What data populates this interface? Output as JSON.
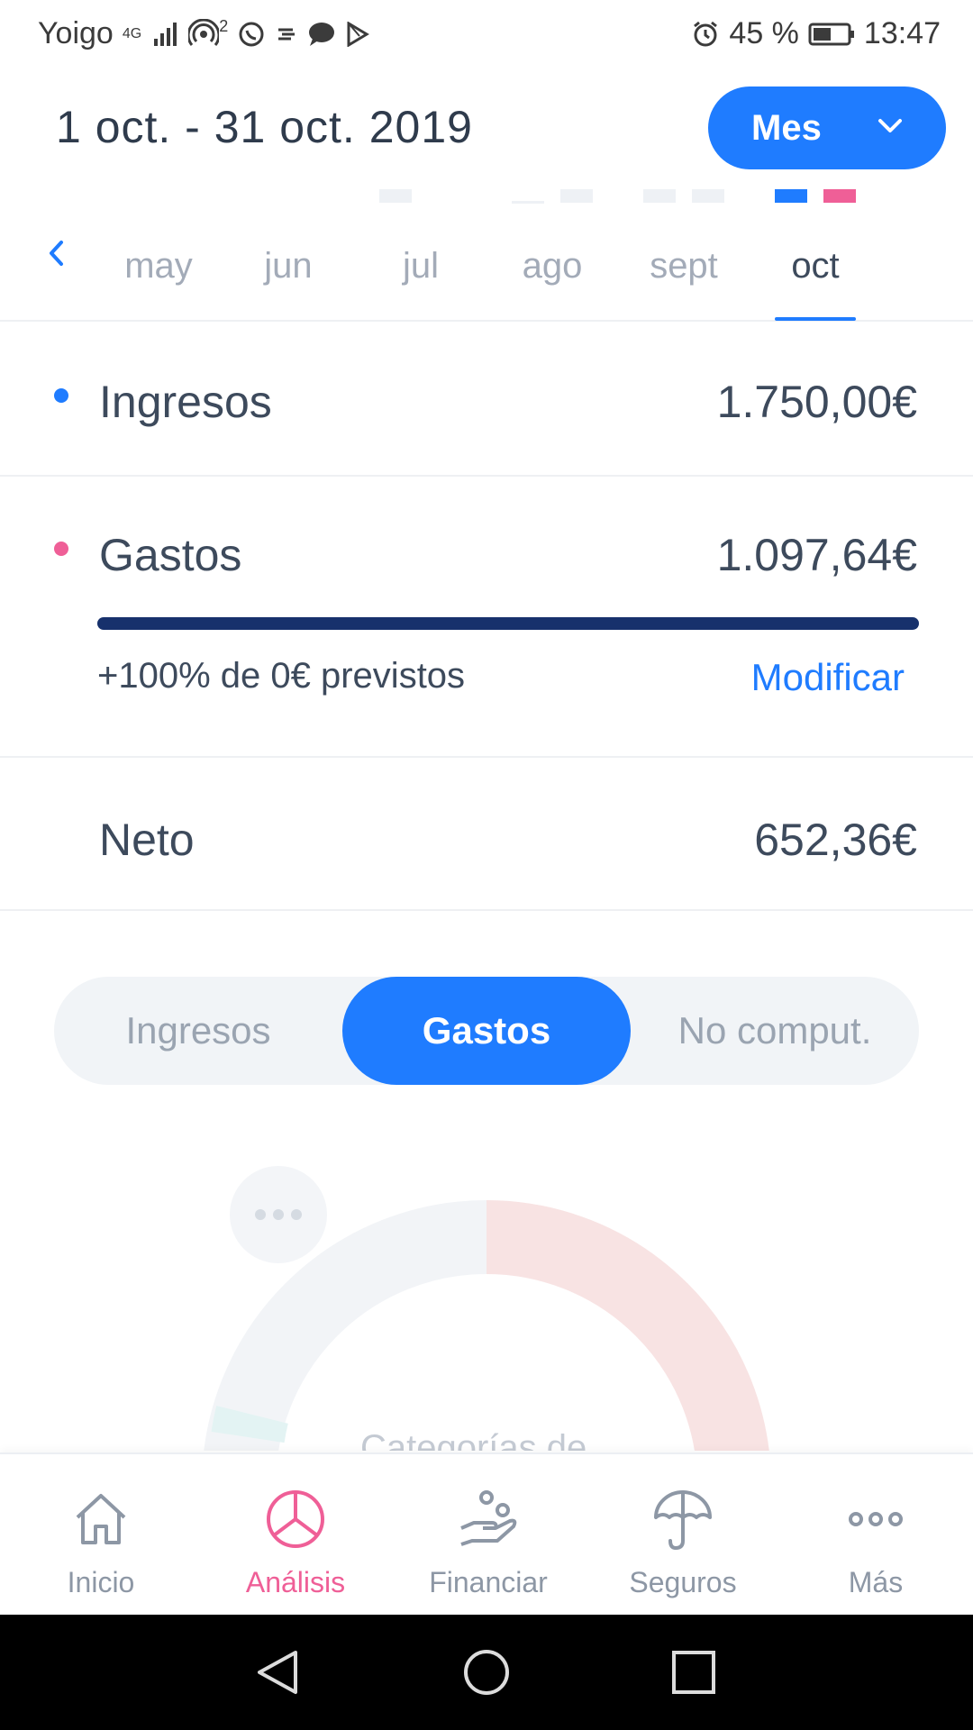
{
  "status_bar": {
    "carrier": "Yoigo",
    "network": "4G",
    "hotspot_badge": "2",
    "battery": "45 %",
    "time": "13:47"
  },
  "header": {
    "date_range": "1 oct. - 31 oct. 2019",
    "period_button": "Mes"
  },
  "months": [
    "may",
    "jun",
    "jul",
    "ago",
    "sept",
    "oct"
  ],
  "selected_month": "oct",
  "summary": {
    "income_label": "Ingresos",
    "income_value": "1.750,00€",
    "expenses_label": "Gastos",
    "expenses_value": "1.097,64€",
    "budget_progress": 1.0,
    "forecast_text": "+100% de 0€ previstos",
    "modify_label": "Modificar",
    "net_label": "Neto",
    "net_value": "652,36€"
  },
  "segment": {
    "options": [
      "Ingresos",
      "Gastos",
      "No comput."
    ],
    "selected": "Gastos"
  },
  "chart": {
    "caption": "Categorías de"
  },
  "bottom_nav": [
    {
      "label": "Inicio",
      "icon": "home-icon"
    },
    {
      "label": "Análisis",
      "icon": "pie-chart-icon",
      "active": true
    },
    {
      "label": "Financiar",
      "icon": "hand-coins-icon"
    },
    {
      "label": "Seguros",
      "icon": "umbrella-icon"
    },
    {
      "label": "Más",
      "icon": "more-dots-icon"
    }
  ],
  "colors": {
    "accent": "#1f7cff",
    "income_dot": "#1f7cff",
    "expense_dot": "#ef5f97",
    "active_nav": "#ef5f97",
    "progress": "#17316c"
  }
}
